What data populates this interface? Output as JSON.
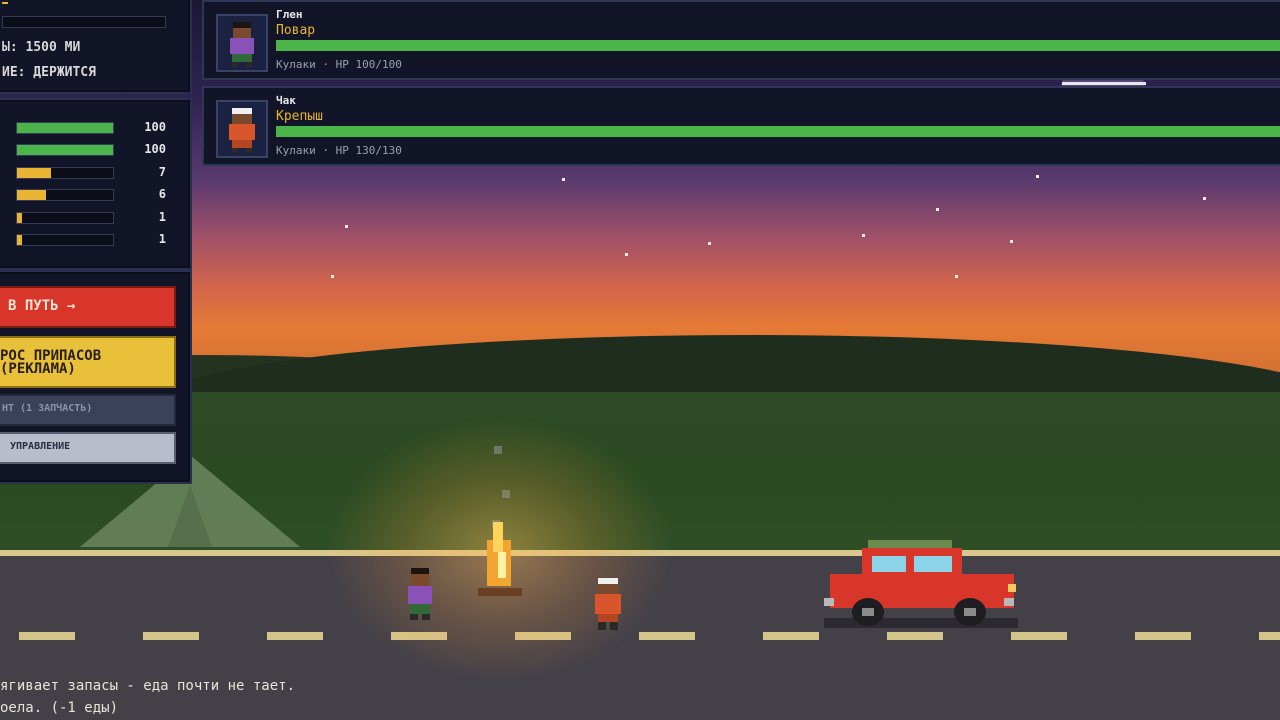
{
  "trip": {
    "distance_text": "Ы: 1500 МИ",
    "state_text": "ИЕ: ДЕРЖИТСЯ"
  },
  "stats": [
    {
      "value": "100",
      "fraction": 1.0,
      "color": "#4cb54a"
    },
    {
      "value": "100",
      "fraction": 1.0,
      "color": "#4cb54a"
    },
    {
      "value": "7",
      "fraction": 0.35,
      "color": "#e8b432"
    },
    {
      "value": "6",
      "fraction": 0.3,
      "color": "#e8b432"
    },
    {
      "value": "1",
      "fraction": 0.05,
      "color": "#e8b432"
    },
    {
      "value": "1",
      "fraction": 0.05,
      "color": "#e8b432"
    }
  ],
  "actions": {
    "go_label": "В ПУТЬ →",
    "supplies_label_line1": "РОС ПРИПАСОВ",
    "supplies_label_line2": "(РЕКЛАМА)",
    "repair_label": "НТ (1 ЗАПЧАСТЬ)",
    "manage_label": "УПРАВЛЕНИЕ"
  },
  "crew": [
    {
      "name": "Глен",
      "role": "Повар",
      "info": "Кулаки · HP 100/100",
      "hp_fraction": 1.0
    },
    {
      "name": "Чак",
      "role": "Крепыш",
      "info": "Кулаки · HP 130/130",
      "hp_fraction": 1.0
    }
  ],
  "log": [
    "ягивает запасы - еда почти не тает.",
    "оела. (-1 еды)"
  ],
  "colors": {
    "go_button": "#d9362b",
    "supplies_button": "#e8c03a",
    "hp_green": "#4cb54a",
    "accent_yellow": "#e8b432"
  }
}
